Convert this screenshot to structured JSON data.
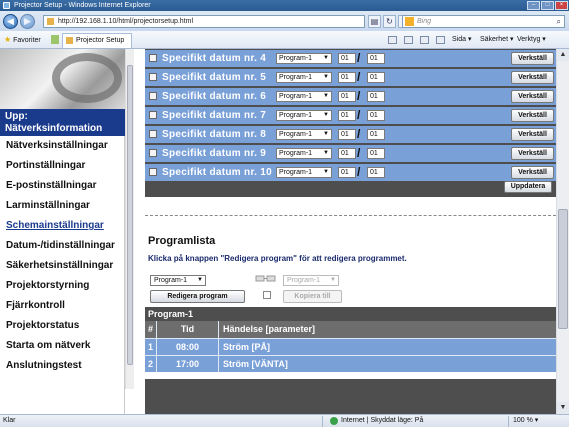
{
  "window": {
    "title": "Projector Setup - Windows Internet Explorer"
  },
  "browser": {
    "url": "http://192.168.1.10/html/projectorsetup.html",
    "search_placeholder": "Bing",
    "favorites_label": "Favoriter",
    "tab_title": "Projector Setup",
    "commands": {
      "page": "Sida",
      "safety": "Säkerhet",
      "tools": "Verktyg"
    }
  },
  "sidebar": {
    "up_label": "Upp:\nNätverksinformation",
    "items": [
      {
        "label": "Nätverksinställningar",
        "active": false
      },
      {
        "label": "Portinställningar",
        "active": false
      },
      {
        "label": "E-postinställningar",
        "active": false
      },
      {
        "label": "Larminställningar",
        "active": false
      },
      {
        "label": "Schemainställningar",
        "active": true
      },
      {
        "label": "Datum-/tidinställningar",
        "active": false
      },
      {
        "label": "Säkerhetsinställningar",
        "active": false
      },
      {
        "label": "Projektorstyrning",
        "active": false
      },
      {
        "label": "Fjärrkontroll",
        "active": false
      },
      {
        "label": "Projektorstatus",
        "active": false
      },
      {
        "label": "Starta om nätverk",
        "active": false
      },
      {
        "label": "Anslutningstest",
        "active": false
      }
    ]
  },
  "specific_dates": [
    {
      "label": "Specifikt datum nr. 4",
      "program": "Program-1",
      "month": "01",
      "day": "01",
      "apply": "Verkställ"
    },
    {
      "label": "Specifikt datum nr. 5",
      "program": "Program-1",
      "month": "01",
      "day": "01",
      "apply": "Verkställ"
    },
    {
      "label": "Specifikt datum nr. 6",
      "program": "Program-1",
      "month": "01",
      "day": "01",
      "apply": "Verkställ"
    },
    {
      "label": "Specifikt datum nr. 7",
      "program": "Program-1",
      "month": "01",
      "day": "01",
      "apply": "Verkställ"
    },
    {
      "label": "Specifikt datum nr. 8",
      "program": "Program-1",
      "month": "01",
      "day": "01",
      "apply": "Verkställ"
    },
    {
      "label": "Specifikt datum nr. 9",
      "program": "Program-1",
      "month": "01",
      "day": "01",
      "apply": "Verkställ"
    },
    {
      "label": "Specifikt datum nr. 10",
      "program": "Program-1",
      "month": "01",
      "day": "01",
      "apply": "Verkställ"
    }
  ],
  "update_button": "Uppdatera",
  "program_list": {
    "title": "Programlista",
    "hint": "Klicka på knappen \"Redigera program\" för att redigera programmet.",
    "program_select": "Program-1",
    "copy_target_select": "Program-1",
    "edit_button": "Redigera program",
    "copy_button": "Kopiera till"
  },
  "program_table": {
    "name": "Program-1",
    "columns": {
      "num": "#",
      "time": "Tid",
      "event": "Händelse [parameter]"
    },
    "rows": [
      {
        "num": "1",
        "time": "08:00",
        "event": "Ström [PÅ]"
      },
      {
        "num": "2",
        "time": "17:00",
        "event": "Ström [VÄNTA]"
      }
    ]
  },
  "status": {
    "ready": "Klar",
    "zone": "Internet | Skyddat läge: På",
    "zoom": "100 %"
  }
}
